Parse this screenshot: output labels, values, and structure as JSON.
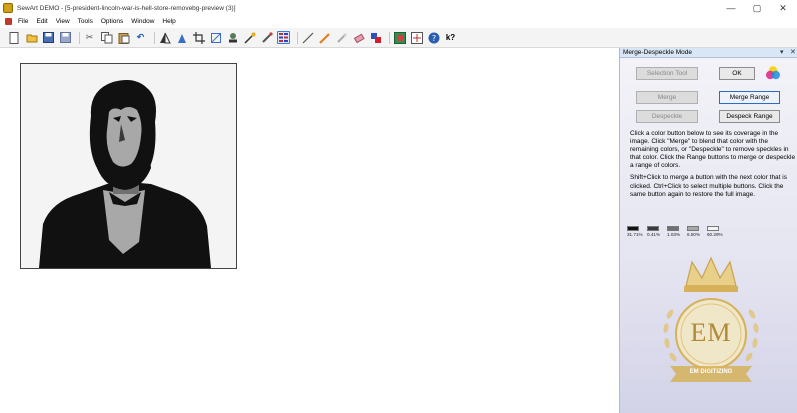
{
  "window": {
    "title": "SewArt DEMO - [5-president-lincoln-war-is-hell-store-removebg-preview (3)]",
    "minimize_glyph": "—",
    "maximize_glyph": "▢",
    "close_glyph": "✕"
  },
  "menu": {
    "items": [
      "File",
      "Edit",
      "View",
      "Tools",
      "Options",
      "Window",
      "Help"
    ]
  },
  "toolbar": {
    "icons": [
      "new-icon",
      "open-icon",
      "save-icon",
      "save-as-icon",
      "cut-icon",
      "copy-icon",
      "paste-icon",
      "undo-icon",
      "flip-icon",
      "rotate-icon",
      "crop-icon",
      "resize-icon",
      "stamp-icon",
      "wand-icon",
      "eyedropper-icon",
      "merge-despeckle-icon",
      "line-icon",
      "pencil-icon",
      "fill-icon",
      "eraser-icon",
      "color-icon",
      "export-icon",
      "stitch-icon",
      "help-icon",
      "whats-this-icon"
    ]
  },
  "panel": {
    "title": "Merge-Despeckle Mode",
    "dropdown_glyph": "▾",
    "close_glyph": "✕",
    "buttons": {
      "selection_tool": "Selection Tool",
      "ok": "OK",
      "merge": "Merge",
      "merge_range": "Merge Range",
      "despeckle": "Despeckle",
      "despeck_range": "Despeck Range"
    },
    "help_paragraph_1": "Click a color button below to see its coverage in the image. Click \"Merge\" to blend that color with the remaining colors, or \"Despeckle\" to remove speckles in that color. Click the Range buttons to merge or despeckle a range of colors.",
    "help_paragraph_2": "Shift+Click to merge a button with the next color that is clicked. Ctrl+Click to select multiple buttons. Click the same button again to restore the full image.",
    "swatches": [
      {
        "color": "#111111",
        "label": "31.71%"
      },
      {
        "color": "#3a3a3a",
        "label": "0.41%"
      },
      {
        "color": "#707070",
        "label": "1.03%"
      },
      {
        "color": "#a8a8a8",
        "label": "6.50%"
      },
      {
        "color": "#f4f4f4",
        "label": "60.29%"
      }
    ]
  },
  "watermark": {
    "monogram": "EM",
    "banner": "EM DIGITIZING"
  },
  "colors": {
    "accent": "#3b7bd6",
    "panel_header": "#d9e6f5",
    "gold": "#d6b15a"
  }
}
